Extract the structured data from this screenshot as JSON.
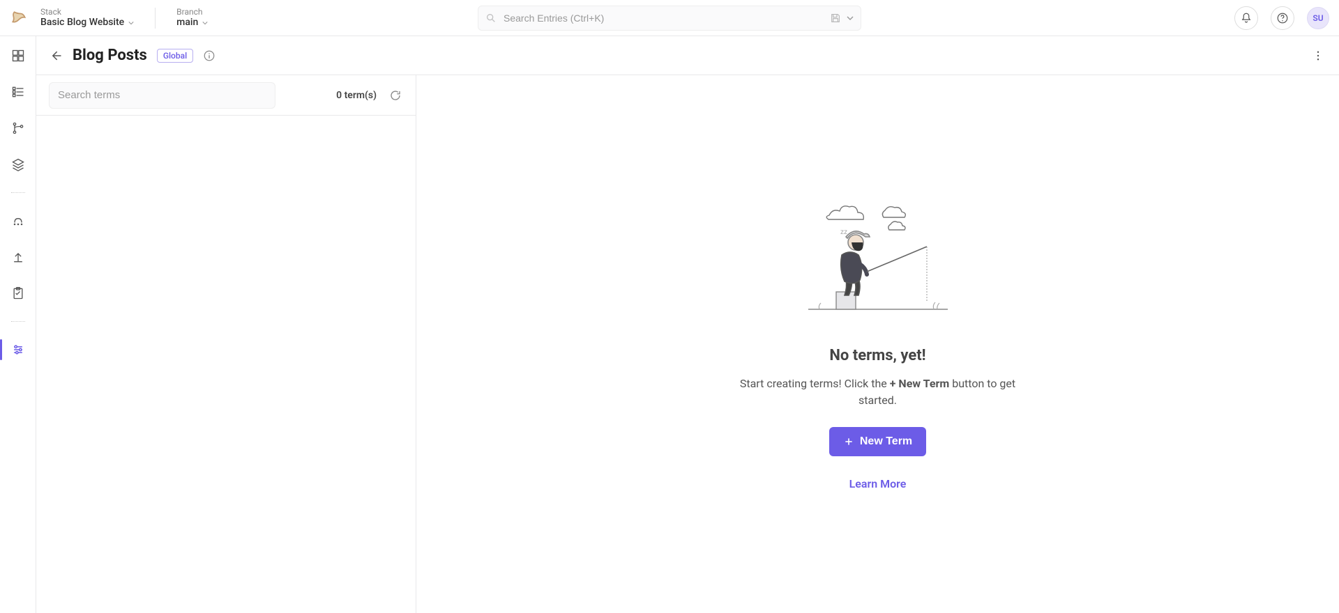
{
  "header": {
    "stack_label": "Stack",
    "stack_value": "Basic Blog Website",
    "branch_label": "Branch",
    "branch_value": "main",
    "search_placeholder": "Search Entries (Ctrl+K)",
    "user_initials": "SU"
  },
  "page": {
    "title": "Blog Posts",
    "badge": "Global"
  },
  "terms": {
    "search_placeholder": "Search terms",
    "count": "0",
    "count_suffix": "term(s)"
  },
  "empty": {
    "title": "No terms, yet!",
    "subtext_before": "Start creating terms! Click the ",
    "subtext_bold": "+ New Term",
    "subtext_after": " button to get started.",
    "button_label": "New Term",
    "learn_more": "Learn More"
  },
  "rail": {
    "items": [
      "dashboard",
      "entries",
      "branches",
      "layers",
      "releases",
      "publish",
      "tasks",
      "taxonomy"
    ]
  }
}
